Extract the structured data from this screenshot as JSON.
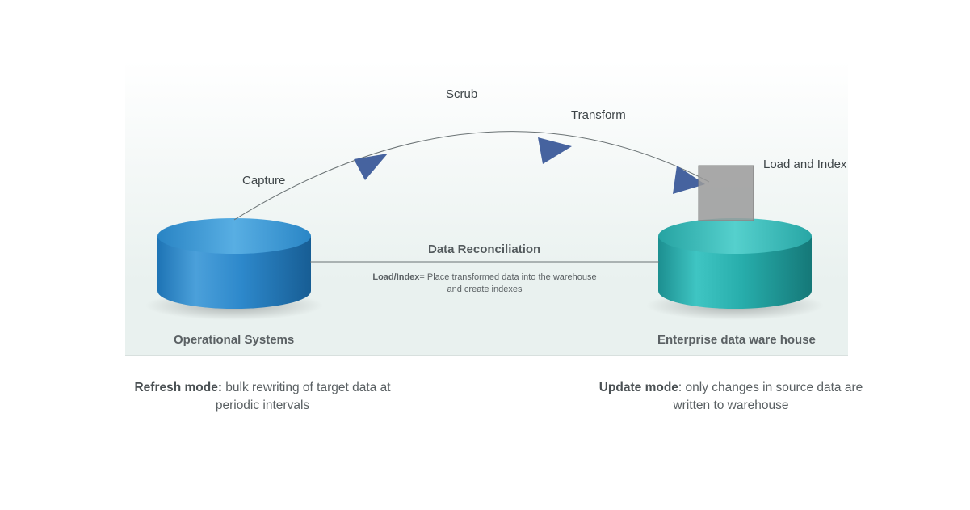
{
  "diagram": {
    "steps": {
      "capture": "Capture",
      "scrub": "Scrub",
      "transform": "Transform",
      "loadIndex": "Load and Index"
    },
    "centerTitle": "Data Reconciliation",
    "note_bold": "Load/Index",
    "note_rest": "= Place transformed data into the warehouse and create indexes",
    "source": "Operational Systems",
    "target": "Enterprise data ware house"
  },
  "captions": {
    "refresh_bold": "Refresh mode:",
    "refresh_rest": " bulk rewriting of target data at periodic intervals",
    "update_bold": "Update mode",
    "update_rest": ": only changes in source data are written to warehouse"
  }
}
